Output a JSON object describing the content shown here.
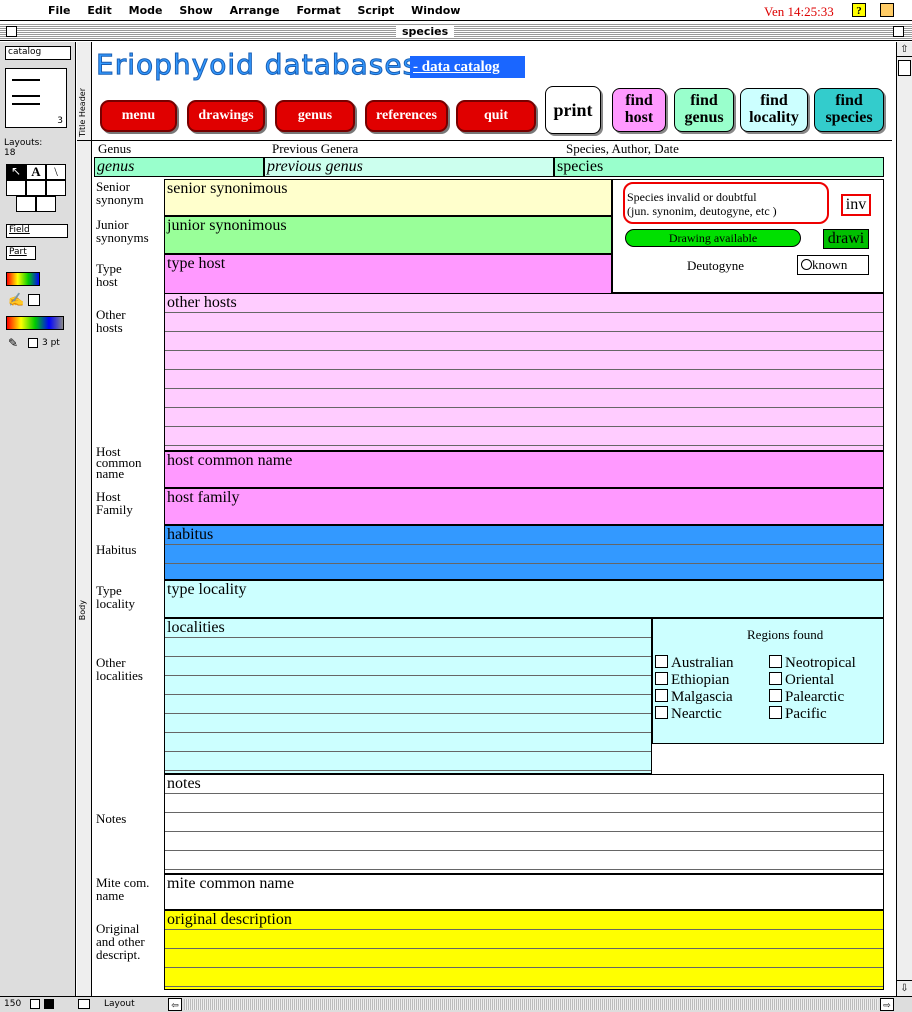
{
  "menubar": {
    "items": [
      "File",
      "Edit",
      "Mode",
      "Show",
      "Arrange",
      "Format",
      "Script",
      "Window"
    ],
    "clock": "Ven 14:25:33"
  },
  "window": {
    "title": "species"
  },
  "toolbar": {
    "db_name": "catalog",
    "layouts_label": "Layouts:",
    "layouts_count": "18",
    "layout_number": "3",
    "field_label": "Field",
    "part_label": "Part",
    "pen_size": "3 pt",
    "zoom": "150",
    "mode": "Layout"
  },
  "parts": {
    "header": "Title Header",
    "body": "Body"
  },
  "header": {
    "title": "Eriophyoid databases",
    "subtitle": "- data catalog",
    "buttons": [
      "menu",
      "drawings",
      "genus",
      "references",
      "quit"
    ],
    "print": "print",
    "find": [
      {
        "l1": "find",
        "l2": "host",
        "color": "#ff99ff"
      },
      {
        "l1": "find",
        "l2": "genus",
        "color": "#99ffcc"
      },
      {
        "l1": "find",
        "l2": "locality",
        "color": "#ccffff"
      },
      {
        "l1": "find",
        "l2": "species",
        "color": "#33cccc"
      }
    ]
  },
  "columns": {
    "genus": "Genus",
    "previous": "Previous Genera",
    "species": "Species, Author, Date"
  },
  "fields": {
    "genus": "genus",
    "previous_genus": "previous genus",
    "species": "species",
    "senior": "senior synonimous",
    "junior": "junior synonimous",
    "type_host": "type host",
    "other_hosts": "other hosts",
    "host_common": "host common name",
    "host_family": "host family",
    "habitus": "habitus",
    "type_locality": "type locality",
    "localities": "localities",
    "notes": "notes",
    "mite_common": "mite common name",
    "original": "original description"
  },
  "labels": {
    "senior": [
      "Senior",
      "synonym"
    ],
    "junior": [
      "Junior",
      "synonyms"
    ],
    "type_host": [
      "Type",
      "host"
    ],
    "other_hosts": [
      "Other",
      "hosts"
    ],
    "host_common": [
      "Host",
      "common",
      "name"
    ],
    "host_family": [
      "Host",
      "Family"
    ],
    "habitus": [
      "Habitus"
    ],
    "type_locality": [
      "Type",
      "locality"
    ],
    "other_localities": [
      "Other",
      "localities"
    ],
    "notes": [
      "Notes"
    ],
    "mite_common": [
      "Mite com.",
      "name"
    ],
    "original": [
      "Original",
      "and other",
      "descript."
    ]
  },
  "status": {
    "invalid_l1": "Species invalid or doubtful",
    "invalid_l2": "(jun. synonim, deutogyne, etc )",
    "inv_field": "inv",
    "drawing_available": "Drawing available",
    "draw_field": "drawi",
    "deutogyne": "Deutogyne",
    "known": "known"
  },
  "regions": {
    "title": "Regions found",
    "left": [
      "Australian",
      "Ethiopian",
      "Malgascia",
      "Nearctic"
    ],
    "right": [
      "Neotropical",
      "Oriental",
      "Palearctic",
      "Pacific"
    ]
  },
  "colors": {
    "genus_row": "#99ffcc",
    "senior": "#ffffcc",
    "junior": "#99ff99",
    "host": "#ffccff",
    "host_dark": "#ff99ff",
    "habitus": "#3399ff",
    "locality": "#ccffff",
    "original": "#ffff00",
    "title_blue": "#3399ff"
  }
}
